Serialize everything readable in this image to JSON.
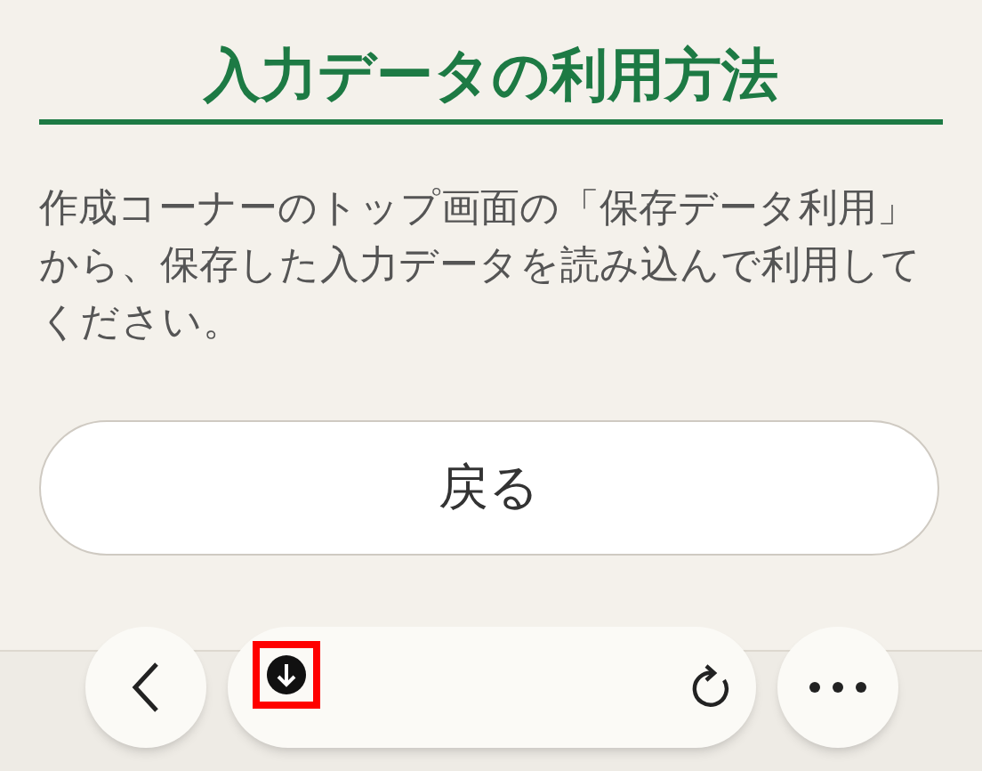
{
  "heading": "入力データの利用方法",
  "body": "作成コーナーのトップ画面の「保存データ利用」から、保存した入力データを読み込んで利用してください。",
  "back_button": "戻る",
  "browser_toolbar": {
    "download_highlighted": true
  }
}
